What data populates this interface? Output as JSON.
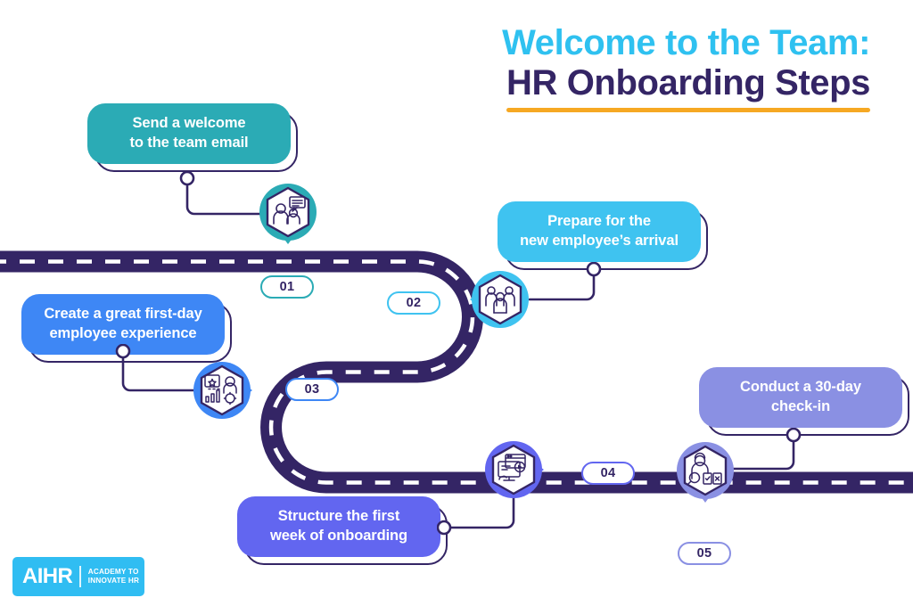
{
  "title": {
    "line1": "Welcome to the Team:",
    "line2": "HR Onboarding Steps",
    "line1_color": "#2FC1F0",
    "line2_color": "#342565",
    "underline_color": "#F6A823"
  },
  "theme": {
    "background": "#ffffff",
    "road_fill": "#342565",
    "road_dash": "#ffffff",
    "outline": "#342565"
  },
  "steps": [
    {
      "number": "01",
      "label": "Send a welcome\nto the team email",
      "line1": "Send a welcome",
      "line2": "to the team email",
      "color": "#2BABB5",
      "icon": "two-people-with-message-icon",
      "pin_direction": "down"
    },
    {
      "number": "02",
      "label": "Prepare for the\nnew employee’s arrival",
      "line1": "Prepare for the",
      "line2": "new employee’s arrival",
      "color": "#3FC3F0",
      "icon": "group-of-people-icon",
      "pin_direction": "left"
    },
    {
      "number": "03",
      "label": "Create a great first-day\nemployee experience",
      "line1": "Create a great first-day",
      "line2": "employee experience",
      "color": "#3E87F5",
      "icon": "employee-experience-chart-icon",
      "pin_direction": "right"
    },
    {
      "number": "04",
      "label": "Structure the first\nweek of onboarding",
      "line1": "Structure the first",
      "line2": "week of onboarding",
      "color": "#6266F0",
      "icon": "computer-training-icon",
      "pin_direction": "right"
    },
    {
      "number": "05",
      "label": "Conduct a 30-day\ncheck-in",
      "line1": "Conduct a 30-day",
      "line2": "check-in",
      "color": "#8A90E3",
      "icon": "person-checklist-review-icon",
      "pin_direction": "down"
    }
  ],
  "logo": {
    "mark": "AIHR",
    "tagline_line1": "ACADEMY TO",
    "tagline_line2": "INNOVATE HR",
    "background": "#30BDF2"
  }
}
